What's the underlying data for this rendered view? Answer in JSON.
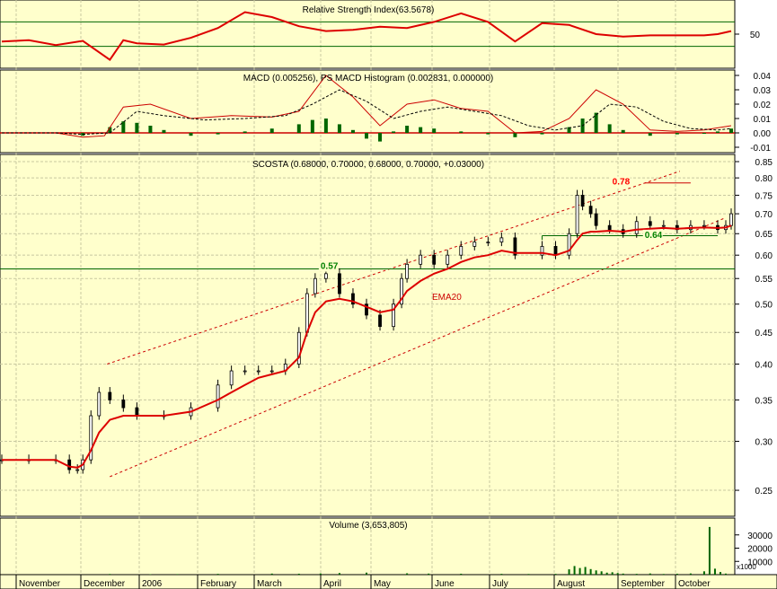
{
  "chart_data": [
    {
      "type": "line",
      "panel": "rsi",
      "title": "Relative Strength Index(63.5678)",
      "ylim": [
        0,
        100
      ],
      "yticks": [
        "50"
      ],
      "levels": [
        30,
        70
      ],
      "x": [
        0,
        10,
        20,
        30,
        40,
        45,
        50,
        60,
        70,
        80,
        90,
        100,
        110,
        120,
        130,
        140,
        150,
        160,
        170,
        180,
        190,
        200,
        210,
        220,
        230,
        240,
        250,
        260,
        265,
        270
      ],
      "values": [
        38,
        40,
        32,
        39,
        8,
        40,
        35,
        33,
        44,
        60,
        86,
        78,
        63,
        55,
        57,
        62,
        60,
        70,
        84,
        70,
        38,
        68,
        65,
        50,
        46,
        48,
        48,
        48,
        50,
        55
      ]
    },
    {
      "type": "line",
      "panel": "macd",
      "title": "MACD (0.005256), PS MACD Histogram (0.002831, 0.000000)",
      "ylim": [
        -0.01,
        0.04
      ],
      "yticks": [
        "0.04",
        "0.03",
        "0.02",
        "0.01",
        "0.00",
        "-0.01"
      ],
      "series": [
        {
          "name": "MACD",
          "x": [
            0,
            20,
            30,
            38,
            45,
            55,
            70,
            85,
            100,
            110,
            120,
            130,
            140,
            150,
            160,
            170,
            180,
            190,
            200,
            210,
            220,
            230,
            240,
            250,
            260,
            270
          ],
          "values": [
            0.0,
            0.0,
            -0.003,
            -0.002,
            0.018,
            0.02,
            0.01,
            0.012,
            0.011,
            0.015,
            0.04,
            0.025,
            0.005,
            0.02,
            0.023,
            0.017,
            0.015,
            0.0,
            0.001,
            0.01,
            0.03,
            0.02,
            0.002,
            0.001,
            0.002,
            0.005
          ]
        },
        {
          "name": "Signal",
          "x": [
            0,
            20,
            30,
            40,
            50,
            60,
            75,
            90,
            105,
            115,
            125,
            135,
            145,
            155,
            165,
            175,
            185,
            195,
            205,
            215,
            225,
            235,
            245,
            255,
            265,
            270
          ],
          "values": [
            0.0,
            0.0,
            -0.001,
            0.0,
            0.015,
            0.012,
            0.009,
            0.01,
            0.012,
            0.02,
            0.03,
            0.022,
            0.01,
            0.015,
            0.018,
            0.015,
            0.012,
            0.005,
            0.002,
            0.005,
            0.02,
            0.018,
            0.008,
            0.003,
            0.002,
            0.003
          ]
        },
        {
          "name": "Histogram",
          "x": [
            30,
            40,
            45,
            50,
            55,
            60,
            70,
            80,
            90,
            100,
            110,
            115,
            120,
            125,
            130,
            135,
            140,
            145,
            150,
            155,
            160,
            170,
            180,
            190,
            200,
            210,
            215,
            220,
            225,
            230,
            240,
            250,
            260,
            265,
            270
          ],
          "values": [
            -0.002,
            0.004,
            0.008,
            0.007,
            0.005,
            0.002,
            -0.002,
            -0.001,
            0.001,
            0.003,
            0.006,
            0.009,
            0.01,
            0.006,
            0.002,
            -0.004,
            -0.006,
            0.001,
            0.005,
            0.004,
            0.003,
            0.001,
            -0.001,
            -0.003,
            -0.001,
            0.004,
            0.01,
            0.014,
            0.006,
            0.002,
            -0.002,
            -0.001,
            0.0,
            0.001,
            0.003
          ]
        }
      ]
    },
    {
      "type": "candlestick",
      "panel": "price",
      "title": "SCOSTA (0.68000, 0.70000, 0.68000, 0.70000, +0.03000)",
      "ylim": [
        0.23,
        0.85
      ],
      "yticks": [
        "0.85",
        "0.80",
        "0.75",
        "0.70",
        "0.65",
        "0.60",
        "0.55",
        "0.50",
        "0.45",
        "0.40",
        "0.35",
        "0.30",
        "0.25"
      ],
      "close_x": [
        0,
        10,
        20,
        25,
        28,
        30,
        33,
        36,
        40,
        45,
        50,
        60,
        70,
        80,
        85,
        90,
        95,
        100,
        105,
        110,
        113,
        116,
        120,
        125,
        130,
        135,
        140,
        145,
        148,
        150,
        155,
        160,
        165,
        170,
        175,
        180,
        185,
        190,
        200,
        205,
        210,
        213,
        215,
        218,
        220,
        225,
        230,
        235,
        240,
        245,
        250,
        255,
        260,
        265,
        268,
        270
      ],
      "close": [
        0.28,
        0.28,
        0.28,
        0.27,
        0.27,
        0.28,
        0.33,
        0.36,
        0.35,
        0.34,
        0.33,
        0.33,
        0.34,
        0.37,
        0.39,
        0.39,
        0.39,
        0.39,
        0.4,
        0.45,
        0.52,
        0.55,
        0.56,
        0.52,
        0.5,
        0.48,
        0.46,
        0.5,
        0.55,
        0.58,
        0.6,
        0.58,
        0.6,
        0.62,
        0.63,
        0.63,
        0.64,
        0.6,
        0.62,
        0.6,
        0.65,
        0.75,
        0.72,
        0.7,
        0.67,
        0.66,
        0.65,
        0.68,
        0.67,
        0.67,
        0.66,
        0.67,
        0.67,
        0.66,
        0.67,
        0.7
      ],
      "ema": [
        0.28,
        0.28,
        0.28,
        0.273,
        0.272,
        0.275,
        0.29,
        0.31,
        0.325,
        0.33,
        0.33,
        0.33,
        0.335,
        0.35,
        0.36,
        0.37,
        0.38,
        0.385,
        0.39,
        0.41,
        0.45,
        0.485,
        0.505,
        0.51,
        0.505,
        0.495,
        0.485,
        0.49,
        0.51,
        0.525,
        0.545,
        0.56,
        0.57,
        0.585,
        0.595,
        0.6,
        0.61,
        0.605,
        0.605,
        0.6,
        0.61,
        0.635,
        0.65,
        0.655,
        0.655,
        0.657,
        0.655,
        0.66,
        0.662,
        0.664,
        0.662,
        0.664,
        0.665,
        0.664,
        0.665,
        0.67
      ],
      "ema_label": "EMA20",
      "annotations": [
        {
          "text": "0.78",
          "value": 0.78,
          "color": "#ff0000"
        },
        {
          "text": "0.64",
          "value": 0.64,
          "color": "#008000"
        },
        {
          "text": "0.57",
          "value": 0.57,
          "color": "#008000"
        }
      ]
    },
    {
      "type": "bar",
      "panel": "volume",
      "title": "Volume (3,653,805)",
      "yticks": [
        "30000",
        "20000",
        "10000"
      ],
      "unit_label": "x1000",
      "x": [
        40,
        55,
        65,
        80,
        100,
        110,
        118,
        125,
        135,
        150,
        158,
        170,
        185,
        195,
        205,
        210,
        212,
        214,
        216,
        218,
        220,
        222,
        224,
        226,
        228,
        230,
        235,
        240,
        245,
        250,
        255,
        260,
        262,
        264,
        266,
        268
      ],
      "values": [
        500,
        300,
        400,
        600,
        800,
        700,
        900,
        1200,
        1500,
        1000,
        800,
        700,
        600,
        500,
        600,
        4000,
        6500,
        5000,
        5800,
        4200,
        3200,
        2500,
        1500,
        1800,
        1200,
        800,
        600,
        900,
        500,
        700,
        900,
        2500,
        36000,
        4500,
        2000,
        800
      ]
    }
  ],
  "xaxis": {
    "months": [
      "November",
      "December",
      "2006",
      "February",
      "March",
      "April",
      "May",
      "June",
      "July",
      "August",
      "September",
      "October"
    ]
  },
  "colors": {
    "background": "#ffffcc",
    "up": "#000000",
    "down": "#000000",
    "rsi": "#dd0000",
    "ema": "#dd0000",
    "macd": "#cc0000",
    "signal": "#000000",
    "histogram": "#006600",
    "level": "#006600",
    "grid": "#c8c8a0"
  }
}
